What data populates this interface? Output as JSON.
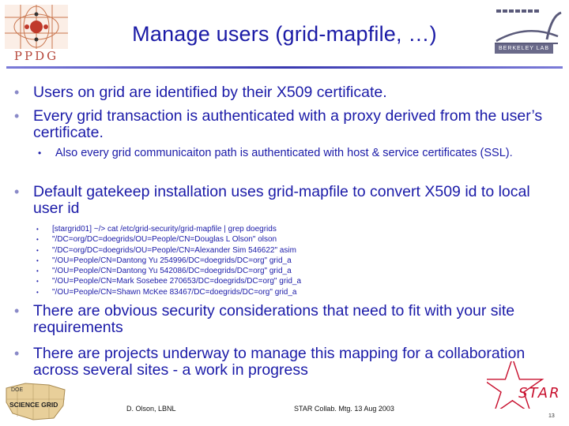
{
  "slide": {
    "title": "Manage users (grid-mapfile, …)",
    "bullets": [
      "Users on grid are identified by their X509 certificate.",
      "Every grid transaction is authenticated with a proxy derived from the user’s certificate."
    ],
    "sub_bullet": "Also every grid communicaiton path is authenticated with host & service certificates (SSL).",
    "bullet3": "Default gatekeep installation uses grid-mapfile to convert X509 id to local user id",
    "code_lines": [
      "[stargrid01] ~/> cat /etc/grid-security/grid-mapfile | grep doegrids",
      "\"/DC=org/DC=doegrids/OU=People/CN=Douglas L Olson\" olson",
      "\"/DC=org/DC=doegrids/OU=People/CN=Alexander Sim 546622\" asim",
      "\"/OU=People/CN=Dantong Yu 254996/DC=doegrids/DC=org\" grid_a",
      "\"/OU=People/CN=Dantong Yu 542086/DC=doegrids/DC=org\" grid_a",
      "\"/OU=People/CN=Mark Sosebee 270653/DC=doegrids/DC=org\" grid_a",
      "\"/OU=People/CN=Shawn McKee 83467/DC=doegrids/DC=org\" grid_a"
    ],
    "bullet4": "There are obvious security considerations that need to fit with your site requirements",
    "bullet5": "There are projects underway to manage this mapping for a collaboration across several sites - a work in progress"
  },
  "logos": {
    "ppdg": "PPDG",
    "berkeley": "BERKELEY LAB",
    "science_grid": "SCIENCE GRID",
    "doe": "DOE",
    "star": "STAR"
  },
  "footer": {
    "author": "D. Olson, LBNL",
    "event": "STAR Collab. Mtg. 13 Aug 2003",
    "page": "13"
  },
  "colors": {
    "text": "#1b1ba8",
    "title": "#1a1aa6",
    "star_red": "#c8102e"
  }
}
